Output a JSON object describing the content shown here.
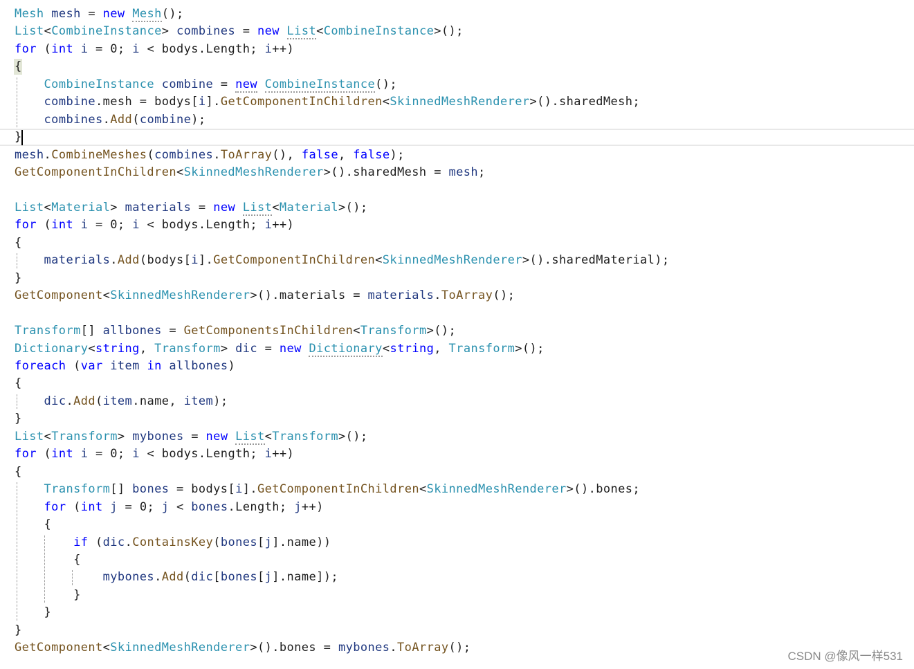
{
  "code": {
    "lines": [
      [
        {
          "t": "Mesh",
          "c": "t"
        },
        {
          "t": " "
        },
        {
          "t": "mesh",
          "c": "v"
        },
        {
          "t": " = "
        },
        {
          "t": "new",
          "c": "k"
        },
        {
          "t": " "
        },
        {
          "t": "Mesh",
          "c": "t",
          "sq": true
        },
        {
          "t": "();"
        }
      ],
      [
        {
          "t": "List",
          "c": "t"
        },
        {
          "t": "<"
        },
        {
          "t": "CombineInstance",
          "c": "t"
        },
        {
          "t": "> "
        },
        {
          "t": "combines",
          "c": "v"
        },
        {
          "t": " = "
        },
        {
          "t": "new",
          "c": "k"
        },
        {
          "t": " "
        },
        {
          "t": "List",
          "c": "t",
          "sq": true
        },
        {
          "t": "<"
        },
        {
          "t": "CombineInstance",
          "c": "t"
        },
        {
          "t": ">();"
        }
      ],
      [
        {
          "t": "for",
          "c": "k"
        },
        {
          "t": " ("
        },
        {
          "t": "int",
          "c": "k"
        },
        {
          "t": " "
        },
        {
          "t": "i",
          "c": "v"
        },
        {
          "t": " = 0; "
        },
        {
          "t": "i",
          "c": "v"
        },
        {
          "t": " < bodys.Length; "
        },
        {
          "t": "i",
          "c": "v"
        },
        {
          "t": "++)"
        }
      ],
      [
        {
          "t": "{"
        }
      ],
      [
        {
          "t": "    "
        },
        {
          "t": "CombineInstance",
          "c": "t"
        },
        {
          "t": " "
        },
        {
          "t": "combine",
          "c": "v"
        },
        {
          "t": " = "
        },
        {
          "t": "new",
          "c": "k",
          "sq": true
        },
        {
          "t": " "
        },
        {
          "t": "CombineInstance",
          "c": "t",
          "sq": true
        },
        {
          "t": "();"
        }
      ],
      [
        {
          "t": "    "
        },
        {
          "t": "combine",
          "c": "v"
        },
        {
          "t": ".mesh = bodys["
        },
        {
          "t": "i",
          "c": "v"
        },
        {
          "t": "]."
        },
        {
          "t": "GetComponentInChildren",
          "c": "m"
        },
        {
          "t": "<"
        },
        {
          "t": "SkinnedMeshRenderer",
          "c": "t"
        },
        {
          "t": ">().sharedMesh;"
        }
      ],
      [
        {
          "t": "    "
        },
        {
          "t": "combines",
          "c": "v"
        },
        {
          "t": "."
        },
        {
          "t": "Add",
          "c": "m"
        },
        {
          "t": "("
        },
        {
          "t": "combine",
          "c": "v"
        },
        {
          "t": ");"
        }
      ],
      [
        {
          "t": "}"
        }
      ],
      [
        {
          "t": "mesh",
          "c": "v"
        },
        {
          "t": "."
        },
        {
          "t": "CombineMeshes",
          "c": "m"
        },
        {
          "t": "("
        },
        {
          "t": "combines",
          "c": "v"
        },
        {
          "t": "."
        },
        {
          "t": "ToArray",
          "c": "m"
        },
        {
          "t": "(), "
        },
        {
          "t": "false",
          "c": "k"
        },
        {
          "t": ", "
        },
        {
          "t": "false",
          "c": "k"
        },
        {
          "t": ");"
        }
      ],
      [
        {
          "t": "GetComponentInChildren",
          "c": "m"
        },
        {
          "t": "<"
        },
        {
          "t": "SkinnedMeshRenderer",
          "c": "t"
        },
        {
          "t": ">().sharedMesh = "
        },
        {
          "t": "mesh",
          "c": "v"
        },
        {
          "t": ";"
        }
      ],
      [],
      [
        {
          "t": "List",
          "c": "t"
        },
        {
          "t": "<"
        },
        {
          "t": "Material",
          "c": "t"
        },
        {
          "t": "> "
        },
        {
          "t": "materials",
          "c": "v"
        },
        {
          "t": " = "
        },
        {
          "t": "new",
          "c": "k"
        },
        {
          "t": " "
        },
        {
          "t": "List",
          "c": "t",
          "sq": true
        },
        {
          "t": "<"
        },
        {
          "t": "Material",
          "c": "t"
        },
        {
          "t": ">();"
        }
      ],
      [
        {
          "t": "for",
          "c": "k"
        },
        {
          "t": " ("
        },
        {
          "t": "int",
          "c": "k"
        },
        {
          "t": " "
        },
        {
          "t": "i",
          "c": "v"
        },
        {
          "t": " = 0; "
        },
        {
          "t": "i",
          "c": "v"
        },
        {
          "t": " < bodys.Length; "
        },
        {
          "t": "i",
          "c": "v"
        },
        {
          "t": "++)"
        }
      ],
      [
        {
          "t": "{"
        }
      ],
      [
        {
          "t": "    "
        },
        {
          "t": "materials",
          "c": "v"
        },
        {
          "t": "."
        },
        {
          "t": "Add",
          "c": "m"
        },
        {
          "t": "(bodys["
        },
        {
          "t": "i",
          "c": "v"
        },
        {
          "t": "]."
        },
        {
          "t": "GetComponentInChildren",
          "c": "m"
        },
        {
          "t": "<"
        },
        {
          "t": "SkinnedMeshRenderer",
          "c": "t"
        },
        {
          "t": ">().sharedMaterial);"
        }
      ],
      [
        {
          "t": "}"
        }
      ],
      [
        {
          "t": "GetComponent",
          "c": "m"
        },
        {
          "t": "<"
        },
        {
          "t": "SkinnedMeshRenderer",
          "c": "t"
        },
        {
          "t": ">().materials = "
        },
        {
          "t": "materials",
          "c": "v"
        },
        {
          "t": "."
        },
        {
          "t": "ToArray",
          "c": "m"
        },
        {
          "t": "();"
        }
      ],
      [],
      [
        {
          "t": "Transform",
          "c": "t"
        },
        {
          "t": "[] "
        },
        {
          "t": "allbones",
          "c": "v"
        },
        {
          "t": " = "
        },
        {
          "t": "GetComponentsInChildren",
          "c": "m"
        },
        {
          "t": "<"
        },
        {
          "t": "Transform",
          "c": "t"
        },
        {
          "t": ">();"
        }
      ],
      [
        {
          "t": "Dictionary",
          "c": "t"
        },
        {
          "t": "<"
        },
        {
          "t": "string",
          "c": "k"
        },
        {
          "t": ", "
        },
        {
          "t": "Transform",
          "c": "t"
        },
        {
          "t": "> "
        },
        {
          "t": "dic",
          "c": "v"
        },
        {
          "t": " = "
        },
        {
          "t": "new",
          "c": "k"
        },
        {
          "t": " "
        },
        {
          "t": "Dictionary",
          "c": "t",
          "sq": true
        },
        {
          "t": "<"
        },
        {
          "t": "string",
          "c": "k"
        },
        {
          "t": ", "
        },
        {
          "t": "Transform",
          "c": "t"
        },
        {
          "t": ">();"
        }
      ],
      [
        {
          "t": "foreach",
          "c": "k"
        },
        {
          "t": " ("
        },
        {
          "t": "var",
          "c": "k"
        },
        {
          "t": " "
        },
        {
          "t": "item",
          "c": "v"
        },
        {
          "t": " "
        },
        {
          "t": "in",
          "c": "k"
        },
        {
          "t": " "
        },
        {
          "t": "allbones",
          "c": "v"
        },
        {
          "t": ")"
        }
      ],
      [
        {
          "t": "{"
        }
      ],
      [
        {
          "t": "    "
        },
        {
          "t": "dic",
          "c": "v"
        },
        {
          "t": "."
        },
        {
          "t": "Add",
          "c": "m"
        },
        {
          "t": "("
        },
        {
          "t": "item",
          "c": "v"
        },
        {
          "t": ".name, "
        },
        {
          "t": "item",
          "c": "v"
        },
        {
          "t": ");"
        }
      ],
      [
        {
          "t": "}"
        }
      ],
      [
        {
          "t": "List",
          "c": "t"
        },
        {
          "t": "<"
        },
        {
          "t": "Transform",
          "c": "t"
        },
        {
          "t": "> "
        },
        {
          "t": "mybones",
          "c": "v"
        },
        {
          "t": " = "
        },
        {
          "t": "new",
          "c": "k"
        },
        {
          "t": " "
        },
        {
          "t": "List",
          "c": "t",
          "sq": true
        },
        {
          "t": "<"
        },
        {
          "t": "Transform",
          "c": "t"
        },
        {
          "t": ">();"
        }
      ],
      [
        {
          "t": "for",
          "c": "k"
        },
        {
          "t": " ("
        },
        {
          "t": "int",
          "c": "k"
        },
        {
          "t": " "
        },
        {
          "t": "i",
          "c": "v"
        },
        {
          "t": " = 0; "
        },
        {
          "t": "i",
          "c": "v"
        },
        {
          "t": " < bodys.Length; "
        },
        {
          "t": "i",
          "c": "v"
        },
        {
          "t": "++)"
        }
      ],
      [
        {
          "t": "{"
        }
      ],
      [
        {
          "t": "    "
        },
        {
          "t": "Transform",
          "c": "t"
        },
        {
          "t": "[] "
        },
        {
          "t": "bones",
          "c": "v"
        },
        {
          "t": " = bodys["
        },
        {
          "t": "i",
          "c": "v"
        },
        {
          "t": "]."
        },
        {
          "t": "GetComponentInChildren",
          "c": "m"
        },
        {
          "t": "<"
        },
        {
          "t": "SkinnedMeshRenderer",
          "c": "t"
        },
        {
          "t": ">().bones;"
        }
      ],
      [
        {
          "t": "    "
        },
        {
          "t": "for",
          "c": "k"
        },
        {
          "t": " ("
        },
        {
          "t": "int",
          "c": "k"
        },
        {
          "t": " "
        },
        {
          "t": "j",
          "c": "v"
        },
        {
          "t": " = 0; "
        },
        {
          "t": "j",
          "c": "v"
        },
        {
          "t": " < "
        },
        {
          "t": "bones",
          "c": "v"
        },
        {
          "t": ".Length; "
        },
        {
          "t": "j",
          "c": "v"
        },
        {
          "t": "++)"
        }
      ],
      [
        {
          "t": "    {"
        }
      ],
      [
        {
          "t": "        "
        },
        {
          "t": "if",
          "c": "k"
        },
        {
          "t": " ("
        },
        {
          "t": "dic",
          "c": "v"
        },
        {
          "t": "."
        },
        {
          "t": "ContainsKey",
          "c": "m"
        },
        {
          "t": "("
        },
        {
          "t": "bones",
          "c": "v"
        },
        {
          "t": "["
        },
        {
          "t": "j",
          "c": "v"
        },
        {
          "t": "].name))"
        }
      ],
      [
        {
          "t": "        {"
        }
      ],
      [
        {
          "t": "            "
        },
        {
          "t": "mybones",
          "c": "v"
        },
        {
          "t": "."
        },
        {
          "t": "Add",
          "c": "m"
        },
        {
          "t": "("
        },
        {
          "t": "dic",
          "c": "v"
        },
        {
          "t": "["
        },
        {
          "t": "bones",
          "c": "v"
        },
        {
          "t": "["
        },
        {
          "t": "j",
          "c": "v"
        },
        {
          "t": "].name]);"
        }
      ],
      [
        {
          "t": "        }"
        }
      ],
      [
        {
          "t": "    }"
        }
      ],
      [
        {
          "t": "}"
        }
      ],
      [
        {
          "t": "GetComponent",
          "c": "m"
        },
        {
          "t": "<"
        },
        {
          "t": "SkinnedMeshRenderer",
          "c": "t"
        },
        {
          "t": ">().bones = "
        },
        {
          "t": "mybones",
          "c": "v"
        },
        {
          "t": "."
        },
        {
          "t": "ToArray",
          "c": "m"
        },
        {
          "t": "();"
        }
      ]
    ]
  },
  "watermark": "CSDN @像风一样531",
  "colors": {
    "keyword": "#0000ff",
    "type": "#2b91af",
    "method": "#74531f",
    "variable": "#1f377f",
    "plain": "#1e1e1e",
    "current_line_border": "#e8e8e8",
    "brace_match": "#e2e6d6"
  }
}
